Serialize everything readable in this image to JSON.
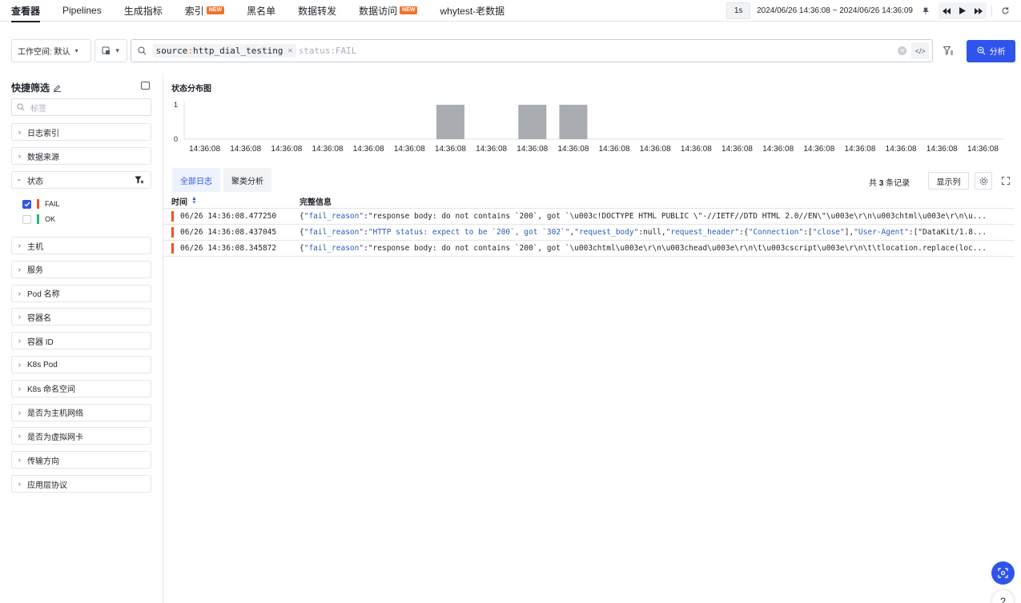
{
  "nav": {
    "tabs": [
      {
        "label": "查看器",
        "badge": ""
      },
      {
        "label": "Pipelines",
        "badge": ""
      },
      {
        "label": "生成指标",
        "badge": ""
      },
      {
        "label": "索引",
        "badge": "NEW"
      },
      {
        "label": "黑名单",
        "badge": ""
      },
      {
        "label": "数据转发",
        "badge": ""
      },
      {
        "label": "数据访问",
        "badge": "NEW"
      },
      {
        "label": "whytest-老数据",
        "badge": ""
      }
    ],
    "interval": "1s",
    "time_range": "2024/06/26 14:36:08 ~ 2024/06/26 14:36:09"
  },
  "search": {
    "workspace_label": "工作空间: 默认",
    "chip": {
      "key": "source",
      "sep": ":",
      "value": "http_dial_testing"
    },
    "placeholder": "status:FAIL",
    "analyze_label": "分析"
  },
  "sidebar": {
    "title": "快捷筛选",
    "search_placeholder": "标签",
    "facets_top": [
      {
        "label": "日志索引"
      },
      {
        "label": "数据来源"
      }
    ],
    "status_facet": {
      "label": "状态",
      "options": [
        {
          "label": "FAIL",
          "checked": true,
          "color": "#f5512a"
        },
        {
          "label": "OK",
          "checked": false,
          "color": "#22b573"
        }
      ]
    },
    "facets_bottom": [
      {
        "label": "主机"
      },
      {
        "label": "服务"
      },
      {
        "label": "Pod 名称"
      },
      {
        "label": "容器名"
      },
      {
        "label": "容器 ID"
      },
      {
        "label": "K8s Pod"
      },
      {
        "label": "K8s 命名空间"
      },
      {
        "label": "是否为主机网络"
      },
      {
        "label": "是否为虚拟网卡"
      },
      {
        "label": "传输方向"
      },
      {
        "label": "应用层协议"
      }
    ]
  },
  "chart_data": {
    "type": "bar",
    "title": "状态分布图",
    "categories": [
      "14:36:08",
      "14:36:08",
      "14:36:08",
      "14:36:08",
      "14:36:08",
      "14:36:08",
      "14:36:08",
      "14:36:08",
      "14:36:08",
      "14:36:08",
      "14:36:08",
      "14:36:08",
      "14:36:08",
      "14:36:08",
      "14:36:08",
      "14:36:08",
      "14:36:08",
      "14:36:08",
      "14:36:08",
      "14:36:08"
    ],
    "values": [
      0,
      0,
      0,
      0,
      0,
      0,
      1,
      0,
      1,
      1,
      0,
      0,
      0,
      0,
      0,
      0,
      0,
      0,
      0,
      0
    ],
    "ylim": [
      0,
      1
    ],
    "yticks": [
      "0",
      "1"
    ],
    "bar_color": "#a9adb2",
    "grid": false
  },
  "logs": {
    "tabs": [
      "全部日志",
      "聚类分析"
    ],
    "records_prefix": "共",
    "records_count": "3",
    "records_suffix": "条记录",
    "columns_button": "显示列",
    "col_time": "时间",
    "col_message": "完整信息",
    "rows": [
      {
        "time": "06/26 14:36:08.477250",
        "message": "{\"fail_reason\":\"response body: do not contains `200`, got `\\u003c!DOCTYPE HTML PUBLIC \\\"-//IETF//DTD HTML 2.0//EN\\\"\\u003e\\r\\n\\u003chtml\\u003e\\r\\n\\u..."
      },
      {
        "time": "06/26 14:36:08.437045",
        "message": "{\"fail_reason\":\"HTTP status: expect to be `200`, got `302`\",\"request_body\":null,\"request_header\":{\"Connection\":[\"close\"],\"User-Agent\":[\"DataKit/1.8..."
      },
      {
        "time": "06/26 14:36:08.345872",
        "message": "{\"fail_reason\":\"response body: do not contains `200`, got `\\u003chtml\\u003e\\r\\n\\u003chead\\u003e\\r\\n\\t\\u003cscript\\u003e\\r\\n\\t\\tlocation.replace(loc..."
      }
    ]
  },
  "help_label": "?"
}
